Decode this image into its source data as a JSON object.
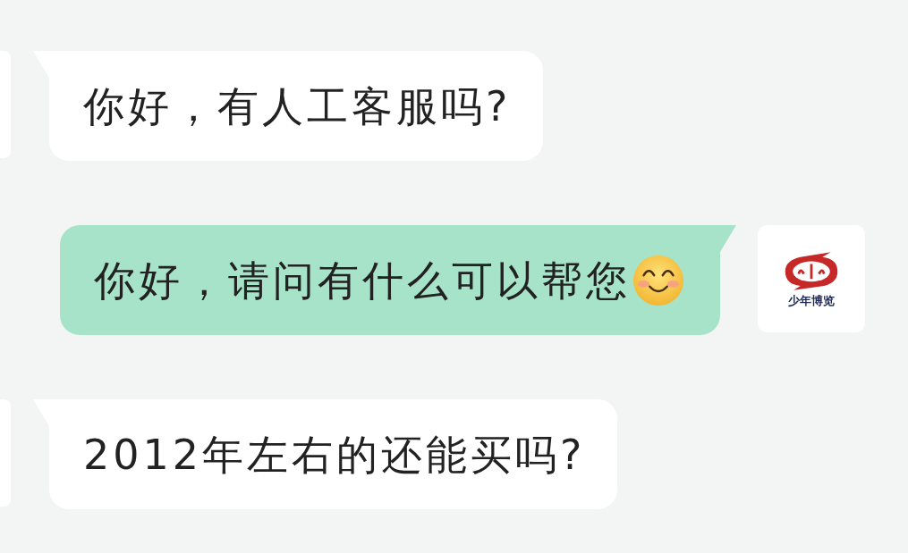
{
  "messages": [
    {
      "kind": "incoming",
      "text": "你好，有人工客服吗?"
    },
    {
      "kind": "outgoing",
      "text": "你好，请问有什么可以帮您",
      "emoji": true,
      "avatar_caption": "少年博览"
    },
    {
      "kind": "incoming",
      "text": "2012年左右的还能买吗?"
    }
  ]
}
